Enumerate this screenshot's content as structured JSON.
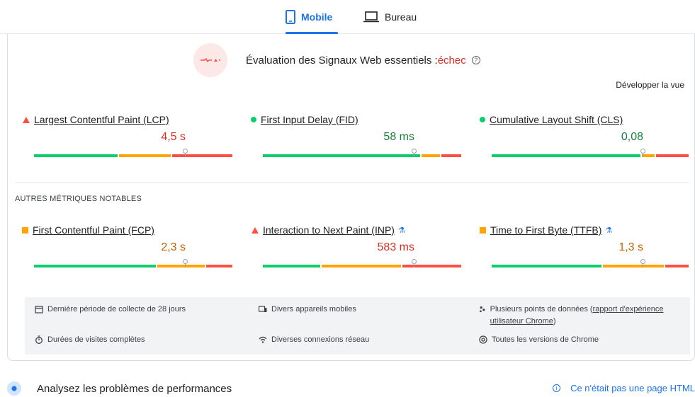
{
  "tabs": [
    {
      "label": "Mobile",
      "active": true
    },
    {
      "label": "Bureau",
      "active": false
    }
  ],
  "assessment": {
    "title": "Évaluation des Signaux Web essentiels :",
    "status": "échec",
    "expand_label": "Développer la vue"
  },
  "core_metrics": [
    {
      "name": "Largest Contentful Paint (LCP)",
      "value": "4,5 s",
      "status": "poor",
      "value_color": "#d93025"
    },
    {
      "name": "First Input Delay (FID)",
      "value": "58 ms",
      "status": "good",
      "value_color": "#188038"
    },
    {
      "name": "Cumulative Layout Shift (CLS)",
      "value": "0,08",
      "status": "good",
      "value_color": "#188038"
    }
  ],
  "other_section_title": "AUTRES MÉTRIQUES NOTABLES",
  "other_metrics": [
    {
      "name": "First Contentful Paint (FCP)",
      "value": "2,3 s",
      "status": "average",
      "value_color": "#c26401"
    },
    {
      "name": "Interaction to Next Paint (INP)",
      "value": "583 ms",
      "status": "poor",
      "value_color": "#d93025"
    },
    {
      "name": "Time to First Byte (TTFB)",
      "value": "1,3 s",
      "status": "average",
      "value_color": "#c26401"
    }
  ],
  "info": {
    "period": "Dernière période de collecte de 28 jours",
    "devices": "Divers appareils mobiles",
    "datapoints_prefix": "Plusieurs points de données (",
    "datapoints_link": "rapport d'expérience utilisateur Chrome",
    "datapoints_suffix": ")",
    "visits": "Durées de visites complètes",
    "connections": "Diverses connexions réseau",
    "versions": "Toutes les versions de Chrome"
  },
  "analyze_label": "Analysez les problèmes de performances",
  "notice_label": "Ce n'était pas une page HTML",
  "colors": {
    "accent": "#1a73e8",
    "good": "#0cce6b",
    "average": "#ffa400",
    "poor": "#ff4e42"
  }
}
